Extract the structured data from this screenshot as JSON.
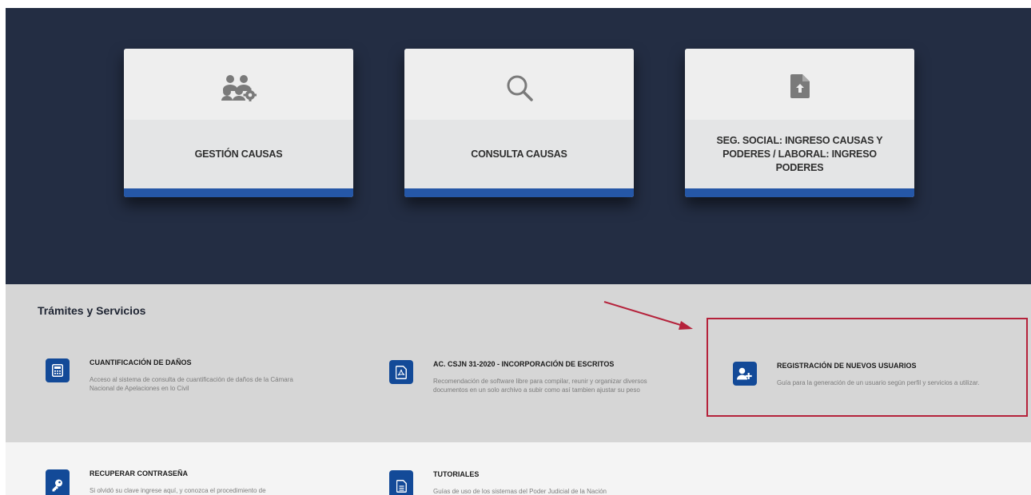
{
  "cards": [
    {
      "label": "GESTIÓN CAUSAS",
      "icon": "users-gear-icon"
    },
    {
      "label": "CONSULTA CAUSAS",
      "icon": "search-icon"
    },
    {
      "label": "SEG. SOCIAL: INGRESO CAUSAS Y PODERES / LABORAL: INGRESO PODERES",
      "icon": "file-upload-icon"
    }
  ],
  "services": {
    "title": "Trámites y Servicios",
    "items": [
      {
        "title": "CUANTIFICACIÓN DE DAÑOS",
        "description": "Acceso al sistema de consulta de cuantificación de daños de la Cámara Nacional de Apelaciones en lo Civil",
        "icon": "calculator-icon"
      },
      {
        "title": "AC. CSJN 31-2020 - INCORPORACIÓN DE ESCRITOS",
        "description": "Recomendación de software libre para compilar, reunir y organizar diversos documentos en un solo archivo a subir como así tambien ajustar su peso",
        "icon": "pdf-file-icon"
      },
      {
        "title": "REGISTRACIÓN DE NUEVOS USUARIOS",
        "description": "Guía para la generación de un usuario según perfil y servicios a utilizar.",
        "icon": "user-plus-icon"
      },
      {
        "title": "RECUPERAR CONTRASEÑA",
        "description": "Si olvidó su clave ingrese aquí, y conozca el procedimiento de",
        "icon": "key-icon"
      },
      {
        "title": "TUTORIALES",
        "description": "Guías de uso de los sistemas del Poder Judicial de la Nación",
        "icon": "document-icon"
      }
    ]
  },
  "colors": {
    "hero_bg": "#232d43",
    "accent_blue": "#2557a7",
    "icon_blue": "#134a98",
    "annotation_red": "#b5223b"
  }
}
